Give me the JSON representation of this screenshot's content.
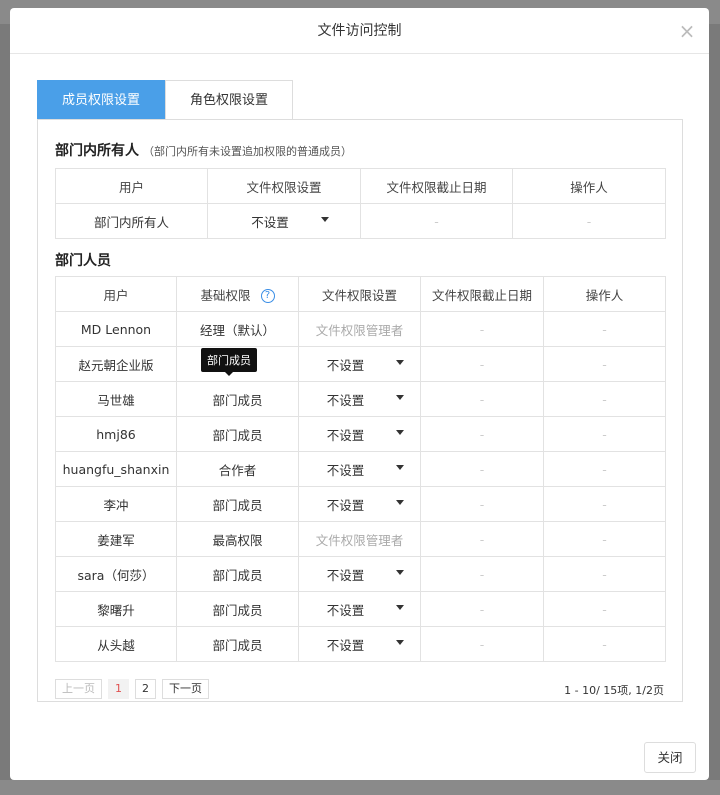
{
  "modal": {
    "title": "文件访问控制",
    "close_label": "×",
    "close_button": "关闭"
  },
  "tabs": [
    {
      "label": "成员权限设置",
      "active": true
    },
    {
      "label": "角色权限设置",
      "active": false
    }
  ],
  "dept_all": {
    "title": "部门内所有人",
    "note": "（部门内所有未设置追加权限的普通成员）",
    "headers": [
      "用户",
      "文件权限设置",
      "文件权限截止日期",
      "操作人"
    ],
    "row": {
      "user": "部门内所有人",
      "perm": "不设置",
      "deadline": "-",
      "operator": "-"
    }
  },
  "members": {
    "title": "部门人员",
    "headers": [
      "用户",
      "基础权限",
      "文件权限设置",
      "文件权限截止日期",
      "操作人"
    ],
    "help_icon": "?",
    "rows": [
      {
        "user": "MD Lennon",
        "base": "经理（默认）",
        "perm": "文件权限管理者",
        "deadline": "-",
        "operator": "-"
      },
      {
        "user": "赵元朝企业版",
        "base": "",
        "perm": "不设置",
        "deadline": "-",
        "operator": "-"
      },
      {
        "user": "马世雄",
        "base": "部门成员",
        "perm": "不设置",
        "deadline": "-",
        "operator": "-"
      },
      {
        "user": "hmj86",
        "base": "部门成员",
        "perm": "不设置",
        "deadline": "-",
        "operator": "-"
      },
      {
        "user": "huangfu_shanxin",
        "base": "合作者",
        "perm": "不设置",
        "deadline": "-",
        "operator": "-"
      },
      {
        "user": "李冲",
        "base": "部门成员",
        "perm": "不设置",
        "deadline": "-",
        "operator": "-"
      },
      {
        "user": "姜建军",
        "base": "最高权限",
        "perm": "文件权限管理者",
        "deadline": "-",
        "operator": "-"
      },
      {
        "user": "sara（何莎）",
        "base": "部门成员",
        "perm": "不设置",
        "deadline": "-",
        "operator": "-"
      },
      {
        "user": "黎曙升",
        "base": "部门成员",
        "perm": "不设置",
        "deadline": "-",
        "operator": "-"
      },
      {
        "user": "从头越",
        "base": "部门成员",
        "perm": "不设置",
        "deadline": "-",
        "operator": "-"
      }
    ],
    "tooltip": "部门成员"
  },
  "pagination": {
    "prev": "上一页",
    "pages": [
      "1",
      "2"
    ],
    "current": "1",
    "next": "下一页",
    "info": "1 - 10/ 15项, 1/2页"
  }
}
